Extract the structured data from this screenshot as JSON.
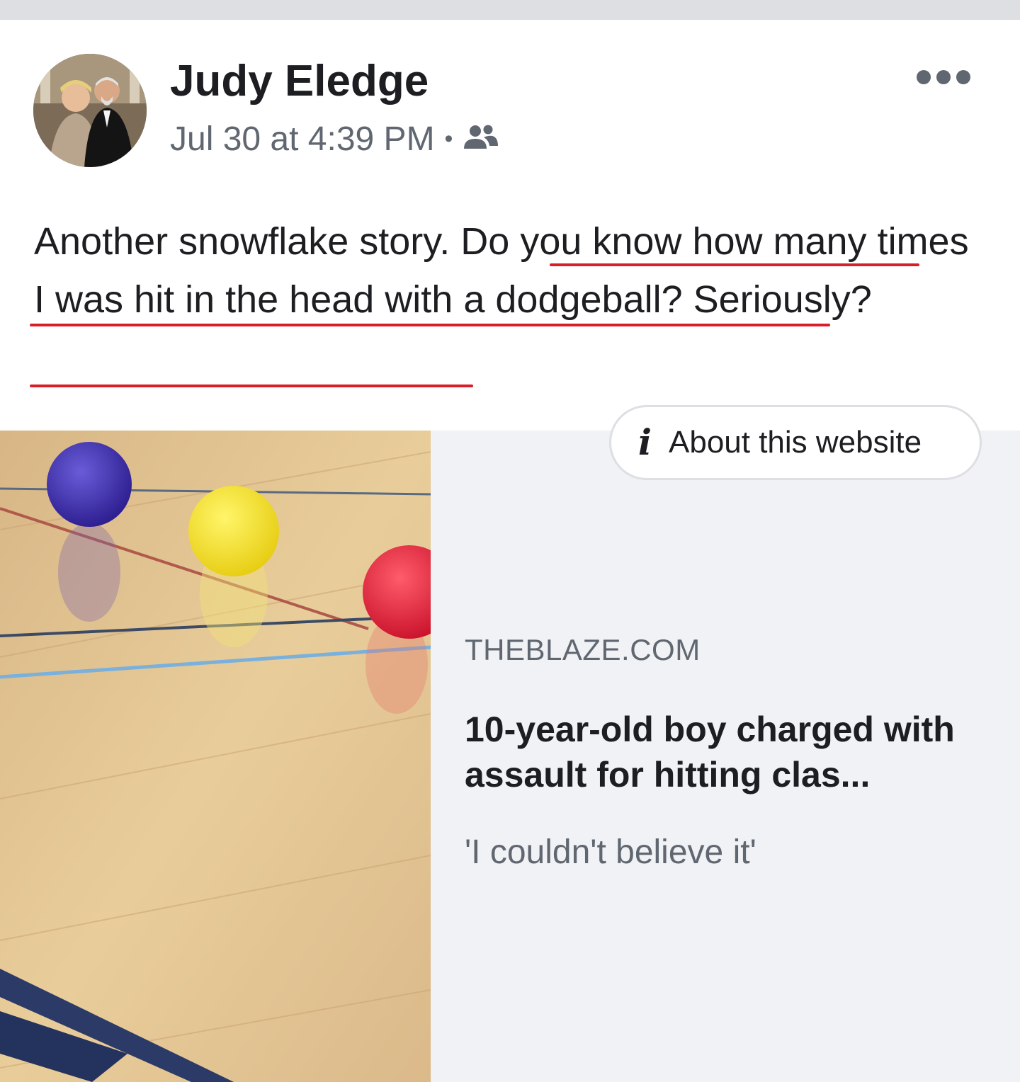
{
  "post": {
    "author": "Judy Eledge",
    "timestamp": "Jul 30 at 4:39 PM",
    "separator": "•",
    "audience_icon": "friends-icon",
    "more_icon": "more-dots-icon",
    "text_plain": "Another snowflake story. ",
    "text_underlined": "Do you know how many times I was hit in the head with a dodgeball?  Seriously?"
  },
  "link_preview": {
    "about_label": "About this website",
    "about_icon": "info-icon",
    "domain": "THEBLAZE.COM",
    "title": "10-year-old boy charged with assault for hitting clas...",
    "description": "'I couldn't believe it'"
  },
  "colors": {
    "underline": "#d91e2a",
    "card_background": "#f0f2f5",
    "secondary_text": "#606770",
    "primary_text": "#1c1e21"
  }
}
